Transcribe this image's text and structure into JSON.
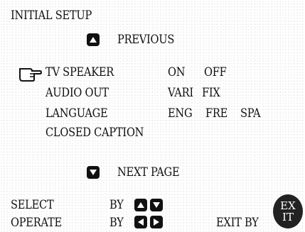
{
  "menu": {
    "title": "INITIAL SETUP",
    "previous_label": "PREVIOUS",
    "next_label": "NEXT PAGE",
    "items": [
      {
        "label": "TV SPEAKER",
        "options": [
          "ON",
          "OFF"
        ],
        "selected": true
      },
      {
        "label": "AUDIO OUT",
        "options": [
          "VARI",
          "FIX"
        ]
      },
      {
        "label": "LANGUAGE",
        "options": [
          "ENG",
          "FRE",
          "SPA"
        ]
      },
      {
        "label": "CLOSED CAPTION",
        "options": []
      }
    ]
  },
  "footer": {
    "select_label": "SELECT",
    "operate_label": "OPERATE",
    "by_label": "BY",
    "exit_label": "EXIT BY",
    "exit_badge_line1": "EX",
    "exit_badge_line2": "IT"
  },
  "icons": {
    "pointer": "pointing-hand-icon",
    "up": "up-arrow-key-icon",
    "down": "down-arrow-key-icon",
    "left": "left-arrow-key-icon",
    "right": "right-arrow-key-icon"
  }
}
